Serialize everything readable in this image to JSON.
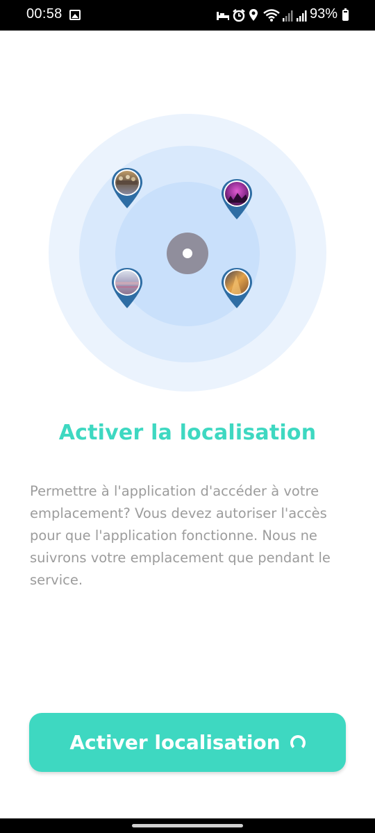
{
  "status_bar": {
    "time": "00:58",
    "battery": "93%",
    "icons": [
      "gallery-icon",
      "sleep-icon",
      "alarm-icon",
      "location-icon",
      "wifi-icon",
      "signal-icon",
      "signal-icon",
      "battery-icon"
    ]
  },
  "illustration": {
    "pins": [
      "place-photo-1",
      "place-photo-2",
      "place-photo-3",
      "place-photo-4"
    ]
  },
  "title": "Activer la localisation",
  "description": "Permettre à l'application d'accéder à votre emplacement? Vous devez autoriser l'accès pour que l'application fonctionne. Nous ne suivrons votre emplacement que pendant le service.",
  "button": {
    "label": "Activer localisation",
    "icon": "loading-spinner-icon"
  },
  "colors": {
    "accent": "#3ed8c1",
    "pin": "#2e6da4",
    "text_muted": "#9c9c9c"
  }
}
